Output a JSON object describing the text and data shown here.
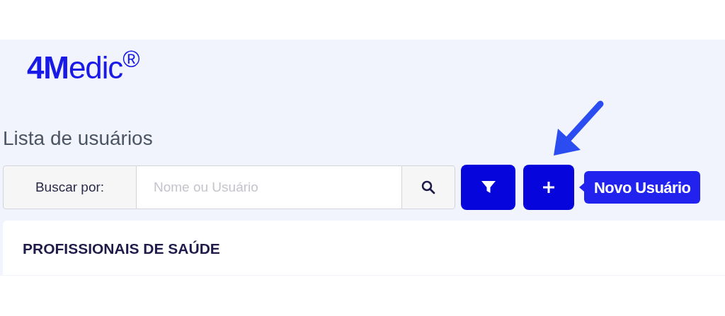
{
  "logo": {
    "text": "**4M**edic$^{®}$"
  },
  "title": "Lista de usuários",
  "search": {
    "label": "Buscar por:",
    "placeholder": "Nome ou Usuário"
  },
  "tooltip": "Novo Usuário",
  "section": {
    "heading": "PROFISSIONAIS DE SAÚDE"
  }
}
